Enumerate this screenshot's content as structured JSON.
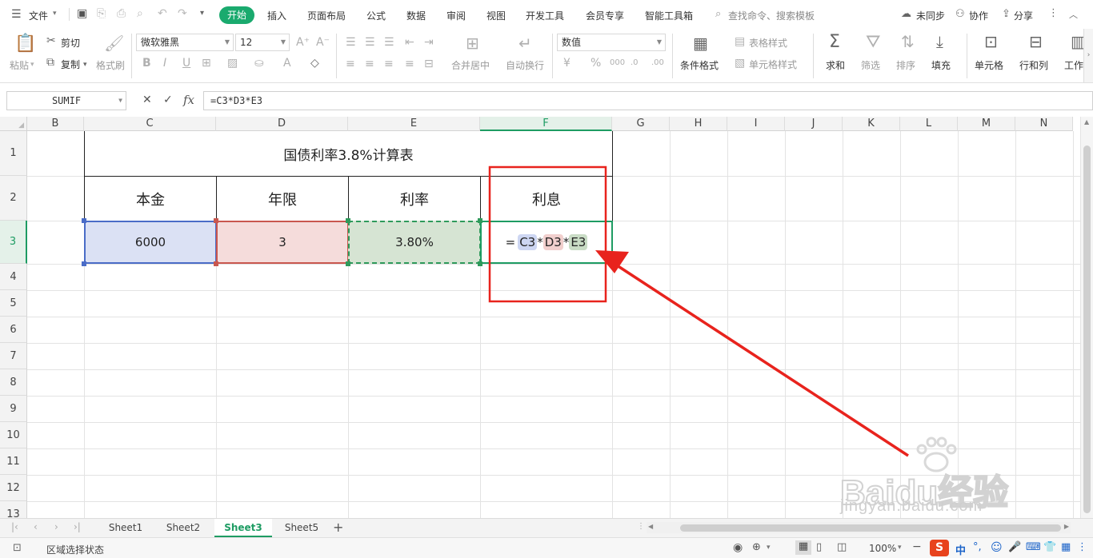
{
  "menubar": {
    "file": "文件",
    "tabs": [
      "开始",
      "插入",
      "页面布局",
      "公式",
      "数据",
      "审阅",
      "视图",
      "开发工具",
      "会员专享",
      "智能工具箱"
    ],
    "search_placeholder": "查找命令、搜索模板",
    "sync": "未同步",
    "collab": "协作",
    "share": "分享"
  },
  "ribbon": {
    "paste": "粘贴",
    "cut": "剪切",
    "copy": "复制",
    "format_painter": "格式刷",
    "font_name": "微软雅黑",
    "font_size": "12",
    "merge_center": "合并居中",
    "wrap_text": "自动换行",
    "number_format": "数值",
    "conditional_format": "条件格式",
    "table_style": "表格样式",
    "cell_style": "单元格样式",
    "sum": "求和",
    "filter": "筛选",
    "sort": "排序",
    "fill": "填充",
    "cell": "单元格",
    "row_col": "行和列",
    "worksheet": "工作"
  },
  "formula_bar": {
    "name_box": "SUMIF",
    "fx": "fx",
    "formula": "=C3*D3*E3"
  },
  "columns": [
    "B",
    "C",
    "D",
    "E",
    "F",
    "G",
    "H",
    "I",
    "J",
    "K",
    "L",
    "M",
    "N"
  ],
  "rows": [
    "1",
    "2",
    "3",
    "4",
    "5",
    "6",
    "7",
    "8",
    "9",
    "10",
    "11",
    "12",
    "13"
  ],
  "table": {
    "title": "国债利率3.8%计算表",
    "headers": [
      "本金",
      "年限",
      "利率",
      "利息"
    ],
    "principal": "6000",
    "years": "3",
    "rate": "3.80%",
    "formula_parts": [
      "=",
      "C3",
      "*",
      "D3",
      "*",
      "E3"
    ]
  },
  "sheets": [
    "Sheet1",
    "Sheet2",
    "Sheet3",
    "Sheet5"
  ],
  "active_sheet": "Sheet3",
  "status": {
    "mode": "区域选择状态",
    "zoom": "100%",
    "ime": "中"
  },
  "watermark": {
    "brand": "Baidu经验",
    "url": "jingyan.baidu.com"
  },
  "colors": {
    "accent": "#1aaa6e",
    "c3_fill": "#dbe1f4",
    "d3_fill": "#f5dcdb",
    "e3_fill": "#d6e4d3",
    "annotation": "#e8231d"
  }
}
